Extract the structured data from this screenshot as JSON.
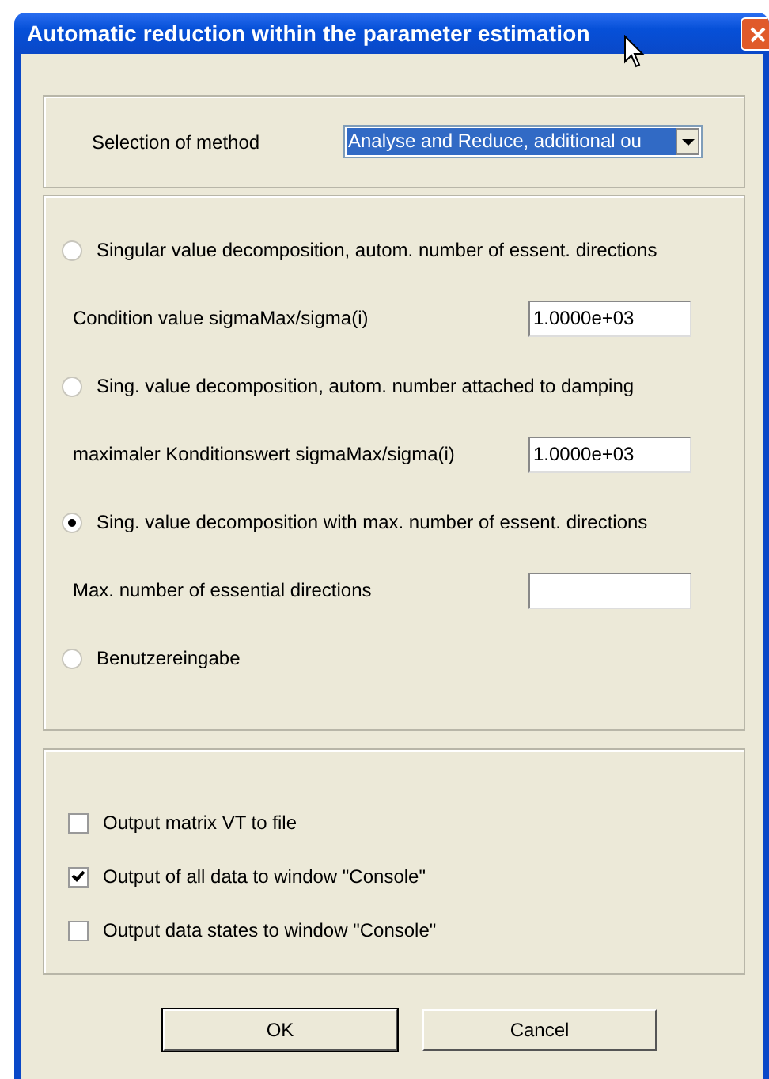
{
  "window": {
    "title": "Automatic reduction within the parameter estimation"
  },
  "method": {
    "label": "Selection of method",
    "value": "Analyse and Reduce, additional ou"
  },
  "options": [
    {
      "label": "Singular value decomposition, autom. number of essent. directions",
      "selected": false,
      "field": {
        "label": "Condition value sigmaMax/sigma(i)",
        "value": "1.0000e+03"
      }
    },
    {
      "label": "Sing. value decomposition, autom. number attached to damping",
      "selected": false,
      "field": {
        "label": "maximaler Konditionswert sigmaMax/sigma(i)",
        "value": "1.0000e+03"
      }
    },
    {
      "label": "Sing. value decomposition with max. number of essent. directions",
      "selected": true,
      "field": {
        "label": "Max. number of essential directions"
      }
    },
    {
      "label": "Benutzereingabe",
      "selected": false
    }
  ],
  "outputs": [
    {
      "label": "Output matrix VT to file",
      "checked": false
    },
    {
      "label": "Output of all data to window \"Console\"",
      "checked": true
    },
    {
      "label": "Output data states to window \"Console\"",
      "checked": false
    }
  ],
  "buttons": [
    {
      "label": "OK",
      "default": true
    },
    {
      "label": "Cancel",
      "default": false
    }
  ]
}
